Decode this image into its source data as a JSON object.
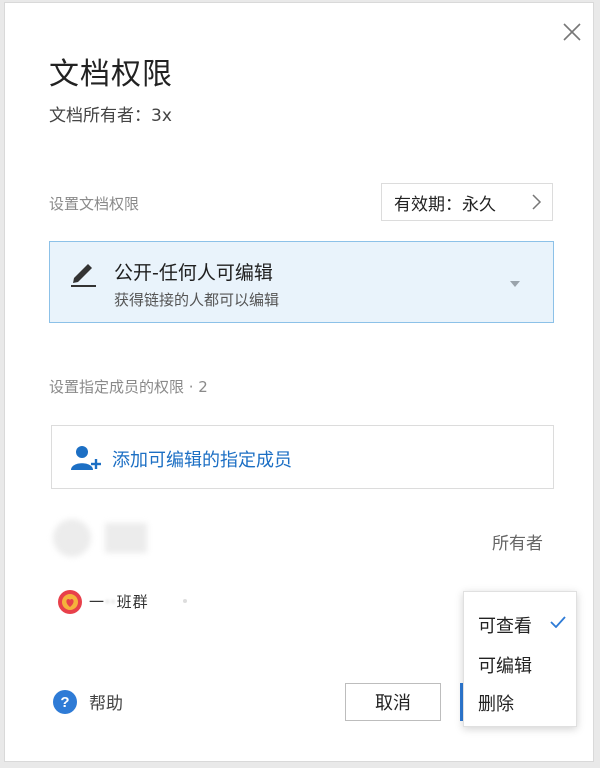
{
  "dialog": {
    "title": "文档权限",
    "owner_line": "文档所有者：3x",
    "close_icon": "close-icon"
  },
  "doc_permission": {
    "section_label": "设置文档权限",
    "validity_label": "有效期：永久",
    "selected_option": {
      "title": "公开-任何人可编辑",
      "subtitle": "获得链接的人都可以编辑",
      "icon": "pen-icon"
    }
  },
  "members": {
    "section_label": "设置指定成员的权限 · 2",
    "add_button_label": "添加可编辑的指定成员",
    "add_icon": "add-user-icon",
    "list": [
      {
        "role": "所有者"
      },
      {
        "name_prefix": "一",
        "name_suffix": "班群"
      }
    ]
  },
  "role_dropdown": {
    "options": [
      "可查看",
      "可编辑",
      "删除"
    ],
    "selected": "可查看"
  },
  "footer": {
    "help_label": "帮助",
    "cancel_label": "取消"
  },
  "colors": {
    "accent": "#1c6fc4",
    "select_bg": "#e9f3fb",
    "select_border": "#8cc1e8"
  }
}
